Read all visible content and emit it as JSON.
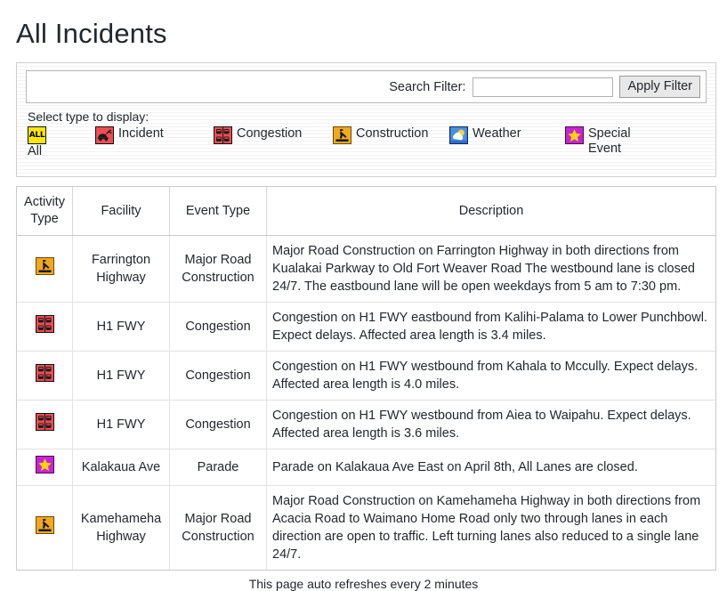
{
  "page": {
    "title": "All Incidents",
    "footnote": "This page auto refreshes every 2 minutes"
  },
  "filter": {
    "search_label": "Search Filter:",
    "search_value": "",
    "search_placeholder": "",
    "apply_label": "Apply Filter",
    "select_label": "Select type to display:",
    "types": [
      {
        "label": "All",
        "icon": "all-icon",
        "color": "#ffe800"
      },
      {
        "label": "Incident",
        "icon": "incident-icon",
        "color": "#ef4d54"
      },
      {
        "label": "Congestion",
        "icon": "congestion-icon",
        "color": "#ef4d54"
      },
      {
        "label": "Construction",
        "icon": "construction-icon",
        "color": "#f0a91e"
      },
      {
        "label": "Weather",
        "icon": "weather-icon",
        "color": "#2f6fce"
      },
      {
        "label": "Special Event",
        "icon": "special-event-icon",
        "color": "#c723d6"
      }
    ]
  },
  "table": {
    "columns": [
      "Activity Type",
      "Facility",
      "Event Type",
      "Description"
    ],
    "rows": [
      {
        "icon": "construction-icon",
        "facility": "Farrington Highway",
        "event_type": "Major Road Construction",
        "description": "Major Road Construction on Farrington Highway in both directions from Kualakai Parkway to Old Fort Weaver Road The westbound lane is closed 24/7. The eastbound lane will be open weekdays from 5 am to 7:30 pm."
      },
      {
        "icon": "congestion-icon",
        "facility": "H1 FWY",
        "event_type": "Congestion",
        "description": "Congestion on H1 FWY eastbound from Kalihi-Palama to Lower Punchbowl. Expect delays. Affected area length is 3.4 miles."
      },
      {
        "icon": "congestion-icon",
        "facility": "H1 FWY",
        "event_type": "Congestion",
        "description": "Congestion on H1 FWY westbound from Kahala to Mccully. Expect delays. Affected area length is 4.0 miles."
      },
      {
        "icon": "congestion-icon",
        "facility": "H1 FWY",
        "event_type": "Congestion",
        "description": "Congestion on H1 FWY westbound from Aiea to Waipahu. Expect delays. Affected area length is 3.6 miles."
      },
      {
        "icon": "special-event-icon",
        "facility": "Kalakaua Ave",
        "event_type": "Parade",
        "description": "Parade on Kalakaua Ave East on April 8th, All Lanes are closed."
      },
      {
        "icon": "construction-icon",
        "facility": "Kamehameha Highway",
        "event_type": "Major Road Construction",
        "description": "Major Road Construction on Kamehameha Highway in both directions from Acacia Road to Waimano Home Road only two through lanes in each direction are open to traffic. Left turning lanes also reduced to a single lane 24/7."
      }
    ]
  }
}
